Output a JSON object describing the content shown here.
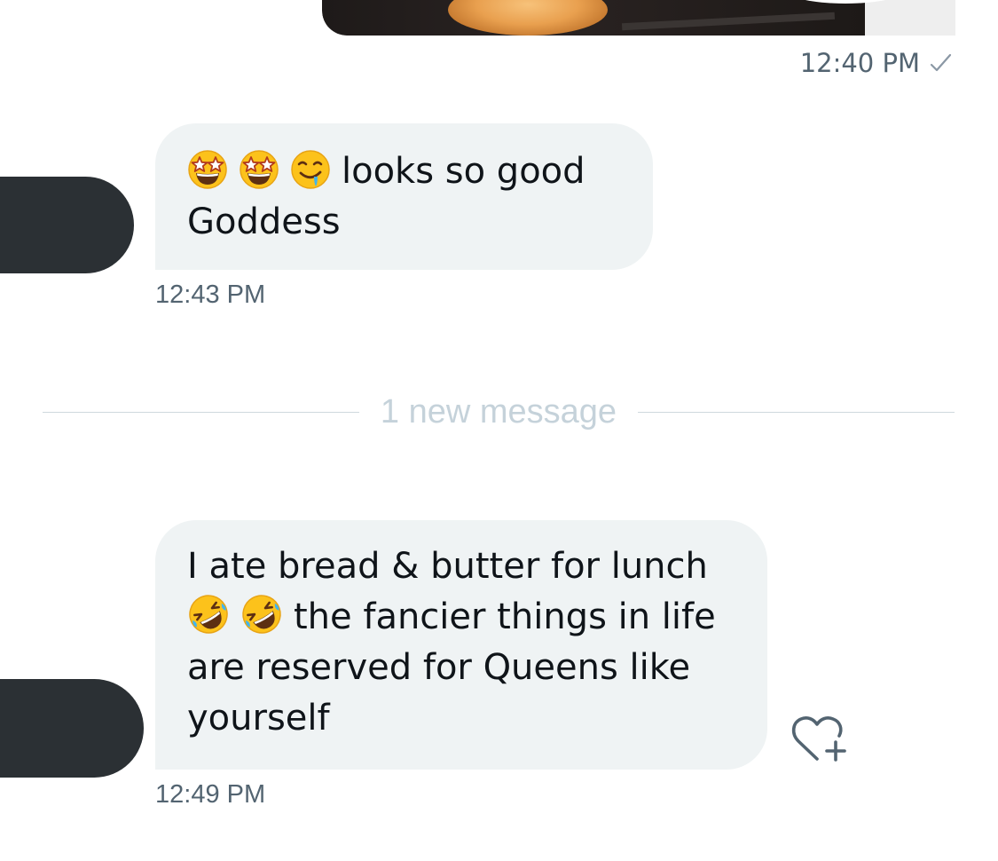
{
  "thread": {
    "sent_image_alt": "photo",
    "sent_time": "12:40 PM",
    "messages": [
      {
        "line1_emojis": [
          "star-struck",
          "star-struck",
          "drooling"
        ],
        "line1_text": "looks so good",
        "line2_text": "Goddess",
        "time": "12:43 PM"
      },
      {
        "line1_text": "I ate bread & butter for lunch",
        "line2_emojis": [
          "rolling-on-floor-laughing",
          "rolling-on-floor-laughing"
        ],
        "line2_text": "the fancier things in life",
        "line3_text": "are reserved for Queens like",
        "line4_text": "yourself",
        "time": "12:49 PM"
      }
    ],
    "divider_text": "1 new message"
  },
  "colors": {
    "bubble_bg": "#eff3f4",
    "text": "#0f1419",
    "timestamp": "#536471",
    "divider": "#cfd9de",
    "avatar": "#2b3034"
  },
  "icons": {
    "sent_status": "check-icon",
    "react": "heart-plus-icon"
  }
}
